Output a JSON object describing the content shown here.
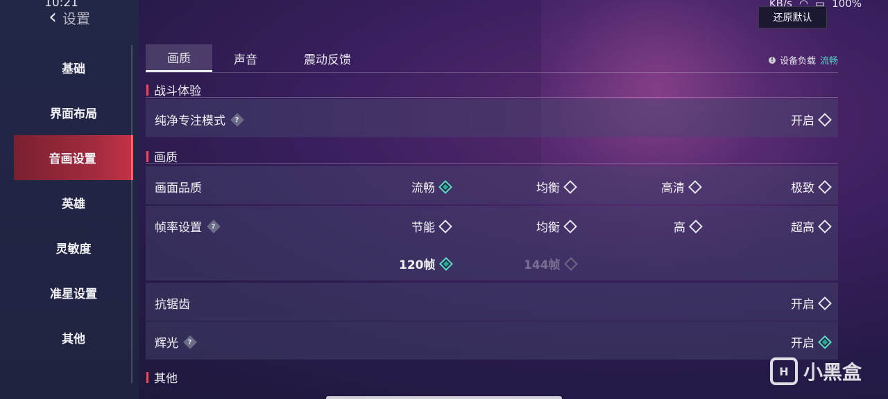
{
  "status_bar": {
    "time": "10:21",
    "net_speed": "KB/s",
    "battery": "100%"
  },
  "header": {
    "title": "设置",
    "reset_label": "还原默认"
  },
  "sidebar": {
    "items": [
      {
        "label": "基础"
      },
      {
        "label": "界面布局"
      },
      {
        "label": "音画设置"
      },
      {
        "label": "英雄"
      },
      {
        "label": "灵敏度"
      },
      {
        "label": "准星设置"
      },
      {
        "label": "其他"
      }
    ],
    "active_index": 2
  },
  "tabs": [
    {
      "label": "画质"
    },
    {
      "label": "声音"
    },
    {
      "label": "震动反馈"
    }
  ],
  "device_load": {
    "label": "设备负载",
    "value": "流畅",
    "value_color": "#54d4c8"
  },
  "sections": {
    "battle": {
      "title": "战斗体验",
      "pure_focus": {
        "label": "纯净专注模式",
        "toggle_label": "开启",
        "checked": false
      }
    },
    "quality": {
      "title": "画质",
      "picture_quality": {
        "label": "画面品质",
        "options": [
          {
            "label": "流畅",
            "selected": true
          },
          {
            "label": "均衡",
            "selected": false
          },
          {
            "label": "高清",
            "selected": false
          },
          {
            "label": "极致",
            "selected": false
          }
        ]
      },
      "frame_rate": {
        "label": "帧率设置",
        "options": [
          {
            "label": "节能",
            "selected": false
          },
          {
            "label": "均衡",
            "selected": false
          },
          {
            "label": "高",
            "selected": false
          },
          {
            "label": "超高",
            "selected": false
          }
        ],
        "fps_options": [
          {
            "label": "120帧",
            "selected": true,
            "enabled": true
          },
          {
            "label": "144帧",
            "selected": false,
            "enabled": false
          }
        ]
      },
      "anti_alias": {
        "label": "抗锯齿",
        "toggle_label": "开启",
        "checked": false
      },
      "glow": {
        "label": "辉光",
        "toggle_label": "开启",
        "checked": true
      }
    },
    "other": {
      "title": "其他"
    }
  },
  "watermark": {
    "text": "小黑盒",
    "logo": "H"
  },
  "colors": {
    "accent_red": "#ff4458",
    "accent_teal": "#54d4c8"
  }
}
